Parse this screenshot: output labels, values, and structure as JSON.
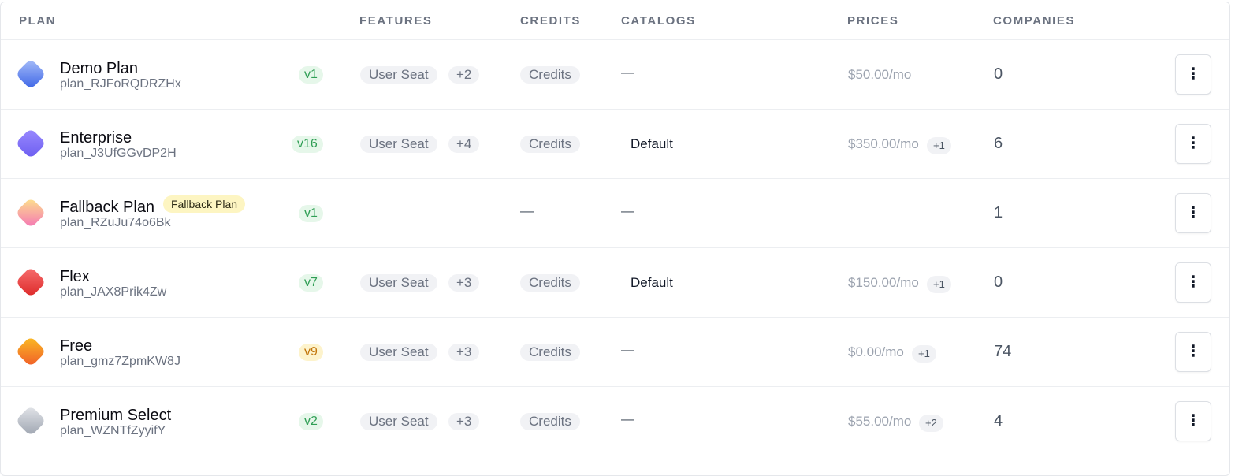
{
  "headers": {
    "plan": "PLAN",
    "features": "FEATURES",
    "credits": "CREDITS",
    "catalogs": "CATALOGS",
    "prices": "PRICES",
    "companies": "COMPANIES"
  },
  "menu_glyph": "⋮",
  "rows": [
    {
      "name": "Demo Plan",
      "id": "plan_RJFoRQDRZHx",
      "version": "v1",
      "version_color": "green",
      "feature": "User Seat",
      "feature_more": "+2",
      "credits": "Credits",
      "catalog": "—",
      "price": "$50.00/mo",
      "price_more": "",
      "companies": "0",
      "icon_gradient": [
        "#a9bff9",
        "#3a63e6"
      ]
    },
    {
      "name": "Enterprise",
      "id": "plan_J3UfGGvDP2H",
      "version": "v16",
      "version_color": "green",
      "feature": "User Seat",
      "feature_more": "+4",
      "credits": "Credits",
      "catalog": "Default",
      "price": "$350.00/mo",
      "price_more": "+1",
      "companies": "6",
      "icon_gradient": [
        "#9b8bff",
        "#6b5cf0"
      ]
    },
    {
      "name": "Fallback Plan",
      "badge": "Fallback Plan",
      "id": "plan_RZuJu74o6Bk",
      "version": "v1",
      "version_color": "green",
      "feature": "",
      "feature_more": "",
      "credits": "—",
      "catalog": "—",
      "price": "",
      "price_more": "",
      "companies": "1",
      "icon_gradient": [
        "#fde68a",
        "#f472b6"
      ]
    },
    {
      "name": "Flex",
      "id": "plan_JAX8Prik4Zw",
      "version": "v7",
      "version_color": "green",
      "feature": "User Seat",
      "feature_more": "+3",
      "credits": "Credits",
      "catalog": "Default",
      "price": "$150.00/mo",
      "price_more": "+1",
      "companies": "0",
      "icon_gradient": [
        "#f87171",
        "#dc2626"
      ]
    },
    {
      "name": "Free",
      "id": "plan_gmz7ZpmKW8J",
      "version": "v9",
      "version_color": "yellow",
      "feature": "User Seat",
      "feature_more": "+3",
      "credits": "Credits",
      "catalog": "—",
      "price": "$0.00/mo",
      "price_more": "+1",
      "companies": "74",
      "icon_gradient": [
        "#fbbf24",
        "#f05a28"
      ]
    },
    {
      "name": "Premium Select",
      "id": "plan_WZNTfZyyifY",
      "version": "v2",
      "version_color": "green",
      "feature": "User Seat",
      "feature_more": "+3",
      "credits": "Credits",
      "catalog": "—",
      "price": "$55.00/mo",
      "price_more": "+2",
      "companies": "4",
      "icon_gradient": [
        "#e5e7eb",
        "#9ca3af"
      ]
    }
  ]
}
